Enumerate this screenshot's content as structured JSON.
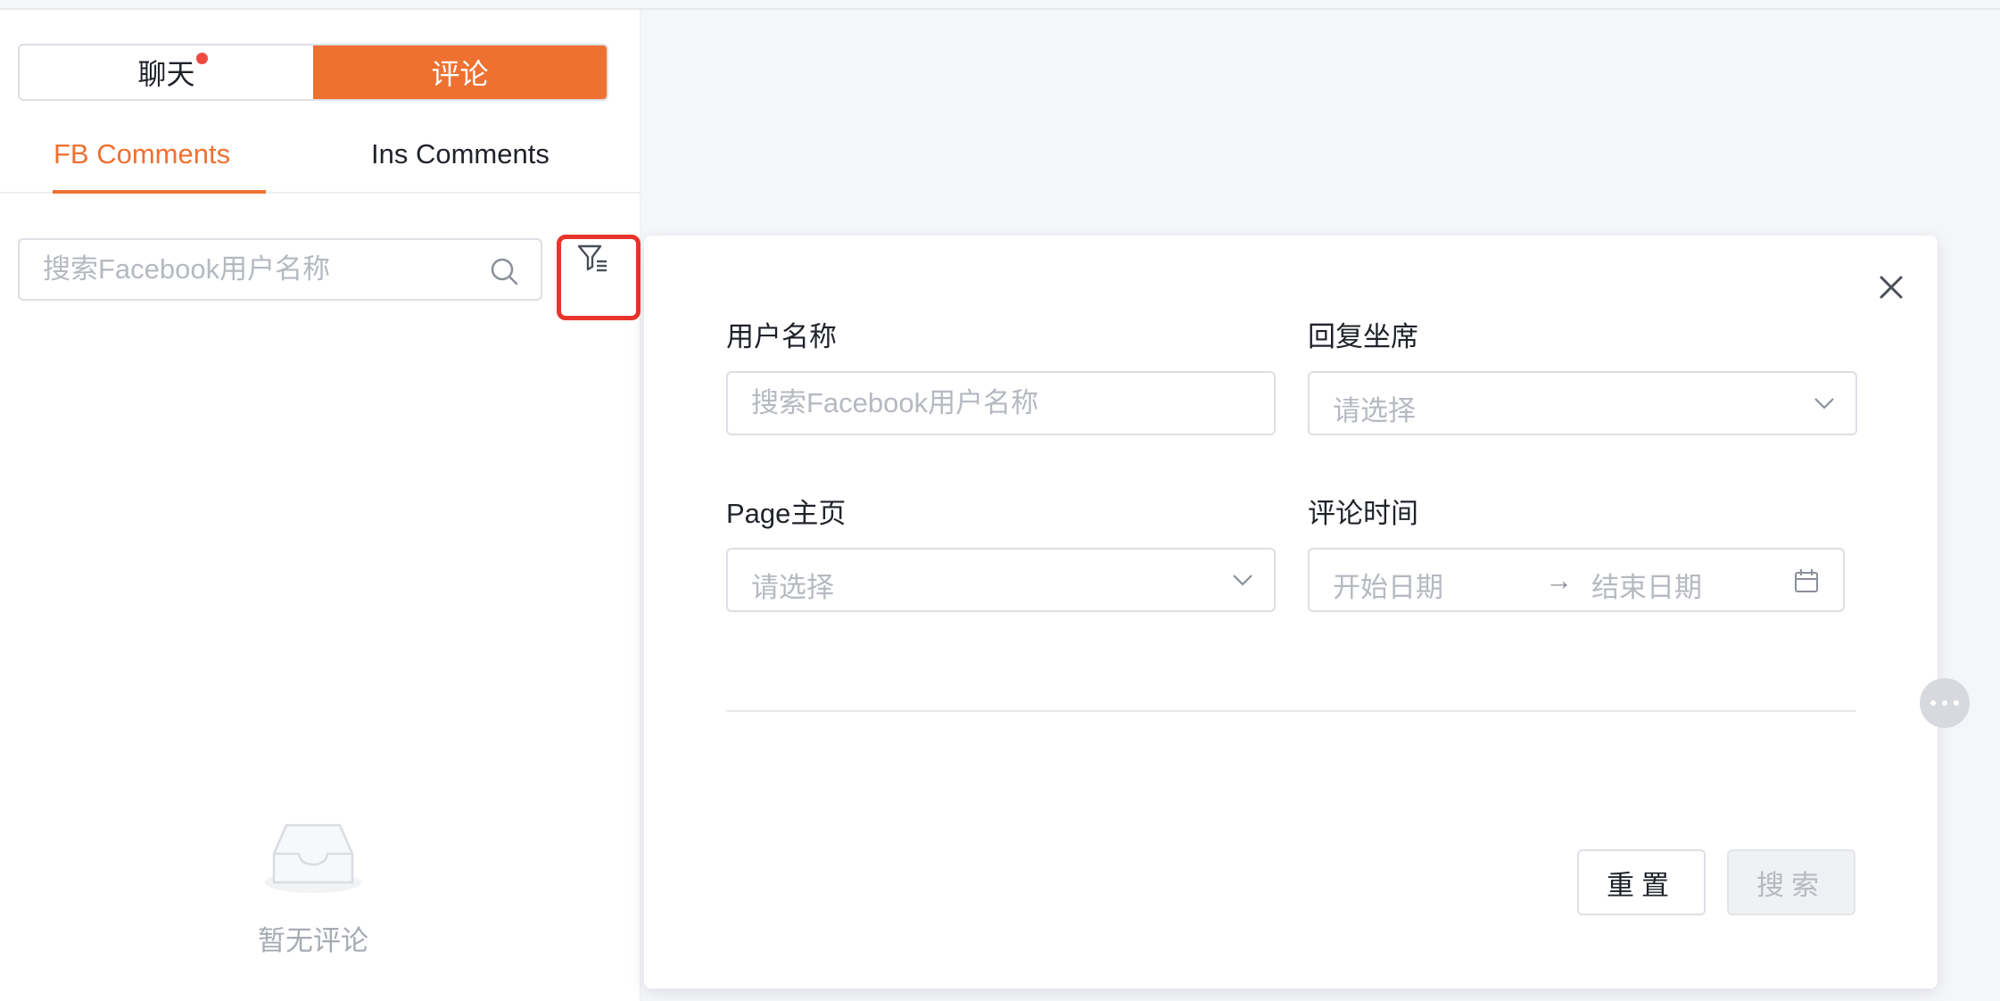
{
  "segment": {
    "chat_label": "聊天",
    "comment_label": "评论",
    "active": "评论",
    "chat_has_unread_dot": true
  },
  "tabs": {
    "fb_label": "FB Comments",
    "ins_label": "Ins Comments",
    "active": "FB Comments"
  },
  "left_search": {
    "placeholder": "搜索Facebook用户名称",
    "value": ""
  },
  "empty_state": {
    "text": "暂无评论"
  },
  "filter_modal": {
    "username": {
      "label": "用户名称",
      "placeholder": "搜索Facebook用户名称",
      "value": ""
    },
    "reply_agent": {
      "label": "回复坐席",
      "placeholder": "请选择"
    },
    "page": {
      "label": "Page主页",
      "placeholder": "请选择"
    },
    "comment_time": {
      "label": "评论时间",
      "start_placeholder": "开始日期",
      "end_placeholder": "结束日期",
      "separator": "→"
    },
    "reset_label": "重置",
    "search_label": "搜索"
  },
  "colors": {
    "accent": "#ee7131",
    "highlight_border": "#e8352c",
    "unread_dot": "#ee4a3f"
  }
}
